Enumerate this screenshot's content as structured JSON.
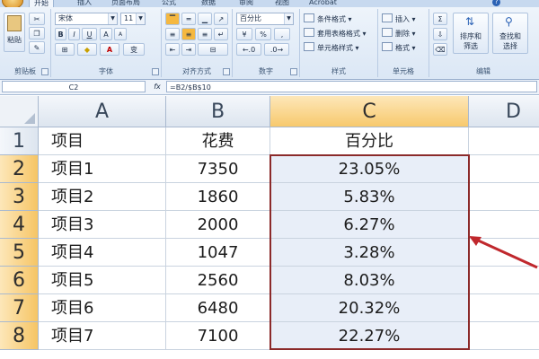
{
  "ribbon": {
    "tabs": [
      {
        "label": "开始",
        "active": true
      },
      {
        "label": "插入",
        "active": false
      },
      {
        "label": "页面布局",
        "active": false
      },
      {
        "label": "公式",
        "active": false
      },
      {
        "label": "数据",
        "active": false
      },
      {
        "label": "审阅",
        "active": false
      },
      {
        "label": "视图",
        "active": false
      },
      {
        "label": "Acrobat",
        "active": false
      }
    ],
    "groups": {
      "clipboard": {
        "label": "剪贴板",
        "paste": "粘贴"
      },
      "font": {
        "label": "字体",
        "font_name": "宋体",
        "font_size": "11",
        "bold": "B",
        "italic": "I",
        "underline": "U",
        "grow": "A",
        "shrink": "A",
        "font_color": "A",
        "phonetic": "变"
      },
      "alignment": {
        "label": "对齐方式"
      },
      "number": {
        "label": "数字",
        "format": "百分比",
        "percent": "%",
        "comma": ","
      },
      "styles": {
        "label": "样式",
        "items": [
          "条件格式",
          "套用表格格式",
          "单元格样式"
        ]
      },
      "cells": {
        "label": "单元格",
        "items": [
          "插入",
          "删除",
          "格式"
        ]
      },
      "editing": {
        "label": "编辑",
        "sum": "Σ",
        "sort": "排序和",
        "sort2": "筛选",
        "find": "查找和",
        "find2": "选择"
      }
    }
  },
  "formula_bar": {
    "name_box": "C2",
    "fx": "fx",
    "formula": "=B2/$B$10"
  },
  "sheet": {
    "columns": [
      "A",
      "B",
      "C",
      "D"
    ],
    "active_column": "C",
    "rows": [
      {
        "num": "1",
        "a": "项目",
        "b": "花费",
        "c": "百分比"
      },
      {
        "num": "2",
        "a": "项目1",
        "b": "7350",
        "c": "23.05%"
      },
      {
        "num": "3",
        "a": "项目2",
        "b": "1860",
        "c": "5.83%"
      },
      {
        "num": "4",
        "a": "项目3",
        "b": "2000",
        "c": "6.27%"
      },
      {
        "num": "5",
        "a": "项目4",
        "b": "1047",
        "c": "3.28%"
      },
      {
        "num": "6",
        "a": "项目5",
        "b": "2560",
        "c": "8.03%"
      },
      {
        "num": "7",
        "a": "项目6",
        "b": "6480",
        "c": "20.32%"
      },
      {
        "num": "8",
        "a": "项目7",
        "b": "7100",
        "c": "22.27%"
      }
    ]
  },
  "colors": {
    "selection_border": "#8b2a2a",
    "annotation_arrow": "#c0282d",
    "active_header": "#f7c96d"
  }
}
